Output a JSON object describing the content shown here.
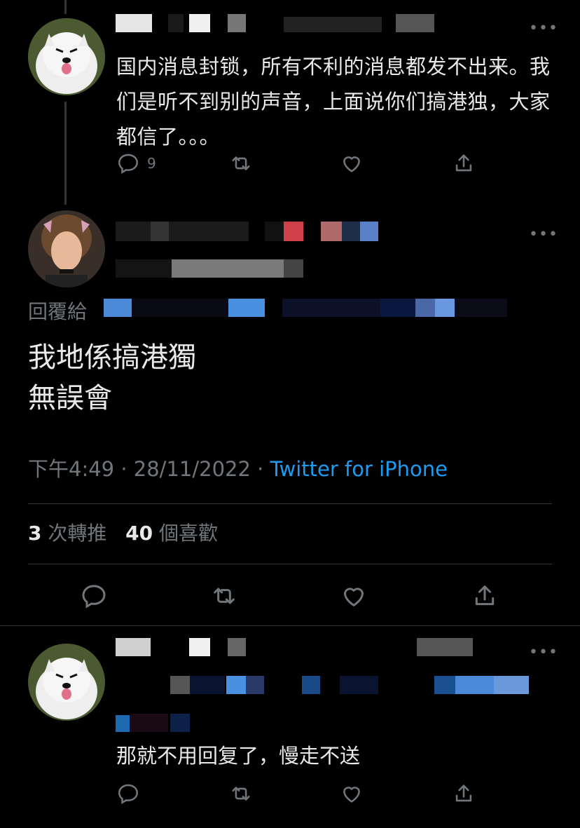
{
  "tweet1": {
    "text": "国内消息封锁，所有不利的消息都发不出来。我们是听不到别的声音，上面说你们搞港独，大家都信了。。。",
    "reply_count": "9"
  },
  "main_tweet": {
    "reply_prefix": "回覆給",
    "text_line1": "我地係搞港獨",
    "text_line2": "無誤會",
    "time": "下午4:49",
    "sep1": "·",
    "date": "28/11/2022",
    "sep2": "·",
    "source": "Twitter for iPhone",
    "retweet_count": "3",
    "retweet_label": "次轉推",
    "like_count": "40",
    "like_label": "個喜歡"
  },
  "tweet3": {
    "text": "那就不用回复了，慢走不送"
  },
  "colors": {
    "background": "#000000",
    "text": "#e7e9ea",
    "muted": "#71767b",
    "link": "#1d9bf0",
    "divider": "#2f3336"
  },
  "icons": [
    "reply-icon",
    "retweet-icon",
    "like-icon",
    "share-icon",
    "more-icon"
  ]
}
